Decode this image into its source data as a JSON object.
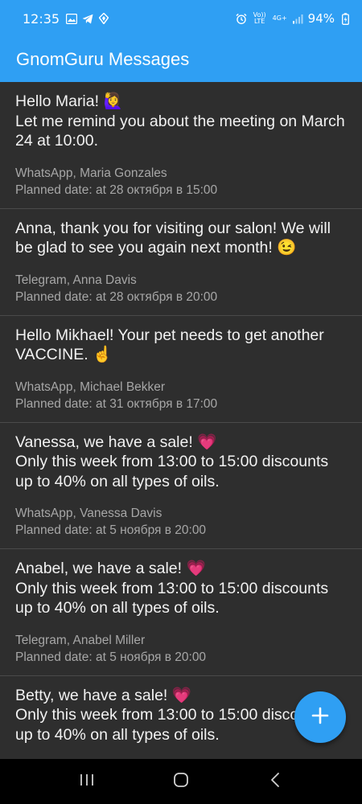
{
  "status_bar": {
    "time": "12:35",
    "volte_label": "Vo)) LTE",
    "network_label": "4G+",
    "battery": "94%"
  },
  "app": {
    "title": "GnomGuru Messages",
    "accent_color": "#2f9ff3"
  },
  "messages": [
    {
      "text": "Hello Maria! 🙋‍♀️\nLet me remind you about the meeting on March 24 at 10:00.",
      "channel": "WhatsApp, Maria Gonzales",
      "planned": "Planned date: at 28 октября в 15:00"
    },
    {
      "text": "Anna, thank you for visiting our salon! We will be glad to see you again next month! 😉",
      "channel": "Telegram, Anna Davis",
      "planned": "Planned date: at 28 октября в 20:00"
    },
    {
      "text": "Hello Mikhael! Your pet needs to get another VACCINE. ☝️",
      "channel": "WhatsApp, Michael Bekker",
      "planned": "Planned date: at 31 октября в 17:00"
    },
    {
      "text": "Vanessa, we have a sale! 💗\nOnly this week from 13:00 to 15:00 discounts up to 40% on all types of oils.",
      "channel": "WhatsApp, Vanessa Davis",
      "planned": "Planned date: at 5 ноября в 20:00"
    },
    {
      "text": "Anabel, we have a sale! 💗\nOnly this week from 13:00 to 15:00 discounts up to 40% on all types of oils.",
      "channel": "Telegram, Anabel Miller",
      "planned": "Planned date: at 5 ноября в 20:00"
    },
    {
      "text": "Betty, we have a sale! 💗\nOnly this week from 13:00 to 15:00 discounts up to 40% on all types of oils.",
      "channel": "",
      "planned": ""
    }
  ],
  "icons": {
    "fab": "plus-icon",
    "nav": [
      "recents-icon",
      "home-icon",
      "back-icon"
    ]
  }
}
